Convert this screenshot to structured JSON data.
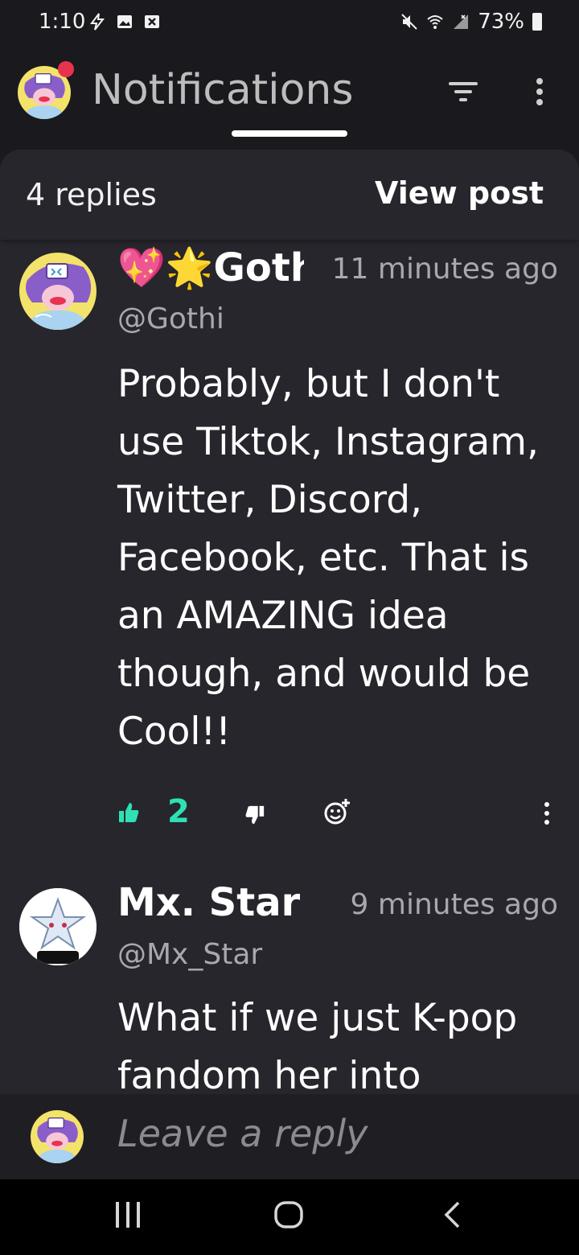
{
  "status_bar": {
    "time": "1:10",
    "battery": "73%",
    "icons": [
      "flash-icon",
      "image-icon",
      "close-box-icon",
      "mute-icon",
      "wifi-icon",
      "signal-icon",
      "battery-icon"
    ]
  },
  "header": {
    "title": "Notifications",
    "filter_icon": "filter-icon",
    "more_icon": "more-vertical-icon"
  },
  "sheet": {
    "replies_label": "4 replies",
    "view_post_label": "View post"
  },
  "comments": [
    {
      "name": "💖🌟Gothi",
      "time": "11 minutes ago",
      "handle": "@Gothi",
      "body": "Probably, but I don't use Tiktok, Instagram, Twitter, Discord, Facebook, etc. That is an AMAZING idea though, and would be Cool!!",
      "likes": "2"
    },
    {
      "name": "Mx. Star",
      "time": "9 minutes ago",
      "handle": "@Mx_Star",
      "body": "What if we just K-pop fandom her into making"
    }
  ],
  "reply_bar": {
    "placeholder": "Leave a reply"
  },
  "colors": {
    "background": "#1a1a1e",
    "sheet": "#27262c",
    "accent_like": "#2fe0b4",
    "notification_dot": "#e8334f"
  }
}
